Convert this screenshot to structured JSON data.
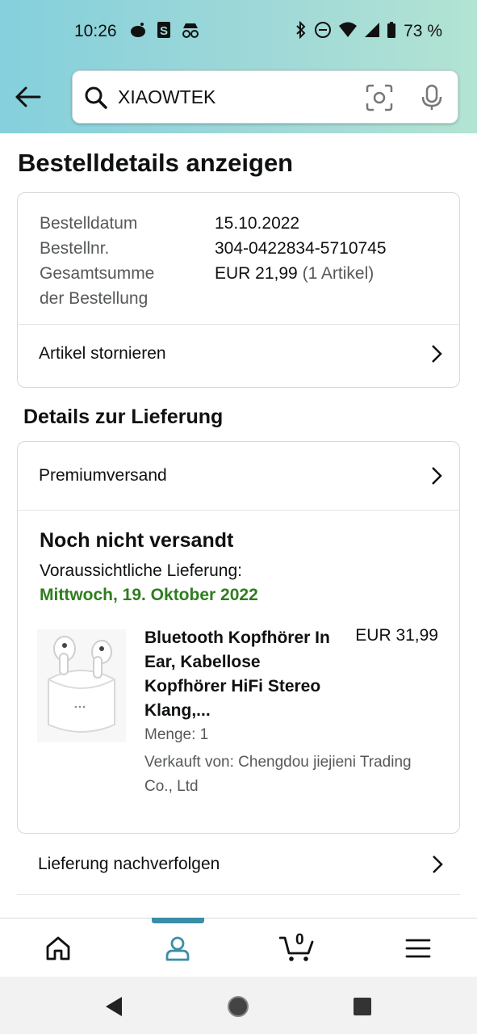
{
  "status_bar": {
    "time": "10:26",
    "battery": "73 %"
  },
  "search": {
    "value": "XIAOWTEK"
  },
  "page_title": "Bestelldetails anzeigen",
  "order_info": {
    "rows": [
      {
        "label": "Bestelldatum",
        "value": "15.10.2022"
      },
      {
        "label": "Bestellnr.",
        "value": "304-0422834-5710745"
      }
    ],
    "total_label_1": "Gesamtsumme",
    "total_label_2": "der Bestellung",
    "total_value": "EUR 21,99",
    "total_items": "(1 Artikel)",
    "cancel_link": "Artikel stornieren"
  },
  "delivery": {
    "section_title": "Details zur Lieferung",
    "shipping_method": "Premiumversand",
    "status_heading": "Noch nicht versandt",
    "expected_label": "Voraussichtliche Lieferung:",
    "expected_date": "Mittwoch, 19. Oktober 2022",
    "date_color": "#2f7d1f",
    "product": {
      "title": "Bluetooth Kopfhörer In Ear, Kabellose Kopfhörer HiFi Stereo Klang,...",
      "price": "EUR 31,99",
      "quantity": "Menge: 1",
      "seller": "Verkauft von: Chengdou jiejieni Trading Co., Ltd"
    },
    "track_link": "Lieferung nachverfolgen"
  },
  "bottom_nav": {
    "cart_count": "0",
    "active_color": "#3a8ea7"
  }
}
